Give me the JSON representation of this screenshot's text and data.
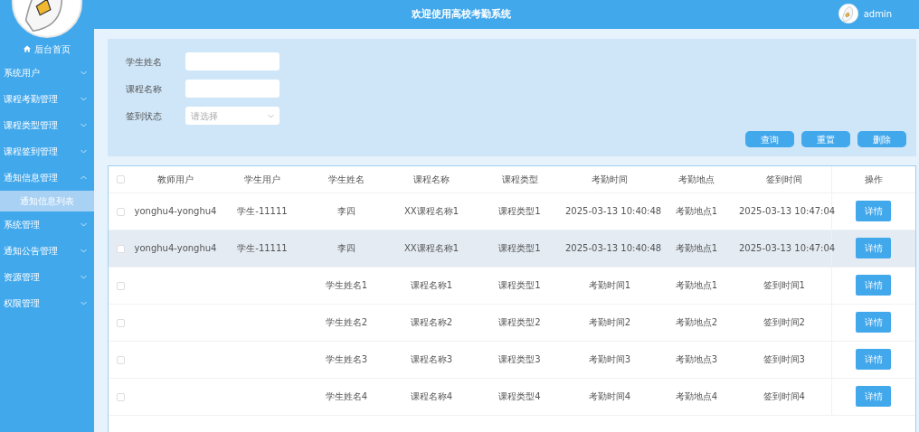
{
  "header": {
    "title": "欢迎使用高校考勤系统",
    "user": "admin"
  },
  "sidebar": {
    "home": "后台首页",
    "items": [
      {
        "label": "系统用户",
        "expanded": false
      },
      {
        "label": "课程考勤管理",
        "expanded": false
      },
      {
        "label": "课程类型管理",
        "expanded": false
      },
      {
        "label": "课程签到管理",
        "expanded": false
      },
      {
        "label": "通知信息管理",
        "expanded": true,
        "children": [
          {
            "label": "通知信息列表",
            "selected": true
          }
        ]
      },
      {
        "label": "系统管理",
        "expanded": false
      },
      {
        "label": "通知公告管理",
        "expanded": false
      },
      {
        "label": "资源管理",
        "expanded": false
      },
      {
        "label": "权限管理",
        "expanded": false
      }
    ]
  },
  "search": {
    "fields": [
      {
        "kind": "text",
        "label": "学生姓名"
      },
      {
        "kind": "text",
        "label": "课程名称"
      },
      {
        "kind": "select",
        "label": "签到状态",
        "placeholder": "请选择"
      }
    ],
    "buttons": [
      "查询",
      "重置",
      "删除"
    ]
  },
  "table": {
    "header_checked": false,
    "columns": [
      "教师用户",
      "学生用户",
      "学生姓名",
      "课程名称",
      "课程类型",
      "考勤时间",
      "考勤地点",
      "签到时间",
      "操作"
    ],
    "rows": [
      {
        "checked": false,
        "hovered": false,
        "cells": [
          "yonghu4-yonghu4",
          "学生-11111",
          "李四",
          "XX课程名称1",
          "课程类型1",
          "2025-03-13 10:40:48",
          "考勤地点1",
          "2025-03-13 10:47:04"
        ],
        "action": "详情"
      },
      {
        "checked": false,
        "hovered": true,
        "cells": [
          "yonghu4-yonghu4",
          "学生-11111",
          "李四",
          "XX课程名称1",
          "课程类型1",
          "2025-03-13 10:40:48",
          "考勤地点1",
          "2025-03-13 10:47:04"
        ],
        "action": "详情"
      },
      {
        "checked": false,
        "hovered": false,
        "cells": [
          "",
          "",
          "学生姓名1",
          "课程名称1",
          "课程类型1",
          "考勤时间1",
          "考勤地点1",
          "签到时间1"
        ],
        "action": "详情"
      },
      {
        "checked": false,
        "hovered": false,
        "cells": [
          "",
          "",
          "学生姓名2",
          "课程名称2",
          "课程类型2",
          "考勤时间2",
          "考勤地点2",
          "签到时间2"
        ],
        "action": "详情"
      },
      {
        "checked": false,
        "hovered": false,
        "cells": [
          "",
          "",
          "学生姓名3",
          "课程名称3",
          "课程类型3",
          "考勤时间3",
          "考勤地点3",
          "签到时间3"
        ],
        "action": "详情"
      },
      {
        "checked": false,
        "hovered": false,
        "cells": [
          "",
          "",
          "学生姓名4",
          "课程名称4",
          "课程类型4",
          "考勤时间4",
          "考勤地点4",
          "签到时间4"
        ],
        "action": "详情"
      }
    ]
  }
}
